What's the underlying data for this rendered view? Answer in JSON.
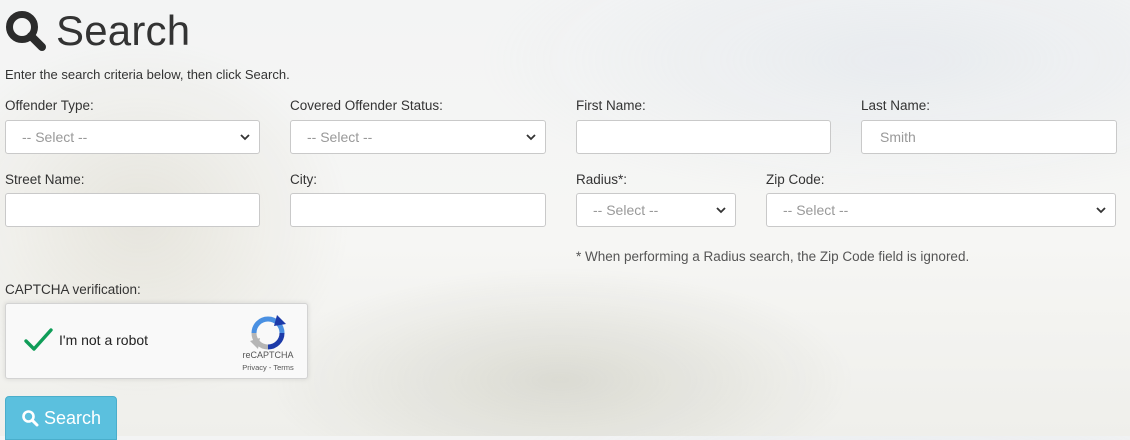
{
  "page": {
    "title": "Search",
    "instructions": "Enter the search criteria below, then click Search.",
    "title_icon": "search-icon"
  },
  "form": {
    "offender_type": {
      "label": "Offender Type:",
      "value": "-- Select --"
    },
    "covered_status": {
      "label": "Covered Offender Status:",
      "value": "-- Select --"
    },
    "first_name": {
      "label": "First Name:",
      "value": "",
      "placeholder": ""
    },
    "last_name": {
      "label": "Last Name:",
      "value": "",
      "placeholder": "Smith"
    },
    "street_name": {
      "label": "Street Name:",
      "value": "",
      "placeholder": ""
    },
    "city": {
      "label": "City:",
      "value": "",
      "placeholder": ""
    },
    "radius": {
      "label": "Radius*:",
      "value": "-- Select --"
    },
    "zip_code": {
      "label": "Zip Code:",
      "value": "-- Select --"
    },
    "radius_note": "* When performing a Radius search, the Zip Code field is ignored."
  },
  "captcha": {
    "label": "CAPTCHA verification:",
    "checkbox_text": "I'm not a robot",
    "checked": true,
    "brand": "reCAPTCHA",
    "links": "Privacy - Terms"
  },
  "actions": {
    "search_label": "Search"
  },
  "colors": {
    "button": "#5bc0de",
    "check": "#0f9d58",
    "title": "#333333"
  }
}
